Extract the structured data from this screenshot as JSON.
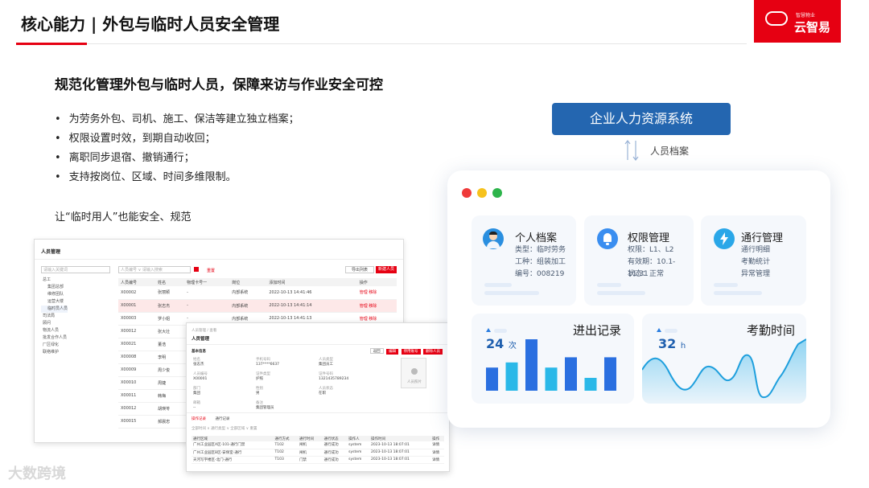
{
  "header": {
    "title": "核心能力 | 外包与临时人员安全管理",
    "logo_small": "智慧物业",
    "logo_brand": "云智易"
  },
  "colors": {
    "brand_red": "#e60012",
    "primary_blue": "#2466b0"
  },
  "subtitle": "规范化管理外包与临时人员，保障来访与作业安全可控",
  "bullets": [
    "为劳务外包、司机、施工、保洁等建立独立档案；",
    "权限设置时效，到期自动收回；",
    "离职同步退宿、撤销通行；",
    "支持按岗位、区域、时间多维限制。"
  ],
  "note": "让“临时用人”也能安全、规范",
  "system": {
    "label": "企业人力资源系统",
    "arrow_label": "人员档案"
  },
  "cards": {
    "profile": {
      "title": "个人档案",
      "lines": [
        "类型：临时劳务",
        "工种：组装加工",
        "编号：008219"
      ]
    },
    "permission": {
      "title": "权限管理",
      "lines": [
        "权限：L1、L2",
        "有效期：10.1-11.31",
        "状态：正常"
      ]
    },
    "access": {
      "title": "通行管理",
      "lines": [
        "通行明细",
        "考勤统计",
        "异常管理"
      ]
    },
    "records": {
      "title": "进出记录",
      "value": "24",
      "unit": "次",
      "bars": [
        0.45,
        0.55,
        1.0,
        0.45,
        0.65,
        0.25,
        0.65
      ]
    },
    "attendance": {
      "title": "考勤时间",
      "value": "32",
      "unit": "h"
    }
  },
  "screenshot1": {
    "title": "人员管理",
    "search_placeholder": "请输入关键词",
    "tree": [
      "总工",
      "集团总部",
      "维修团队",
      "运营大楼",
      "临时员人员",
      "司法局",
      "顾问",
      "物流人员",
      "批发合作人员",
      "厂区绿化",
      "联络维护"
    ],
    "filter": "人员编号 ∨  请输入搜索",
    "reset": "重置",
    "export": "导出列表",
    "add": "新建人员",
    "columns": [
      "人员编号",
      "姓名",
      "物理卡号一",
      "岗位",
      "添加时间",
      "操作"
    ],
    "rows": [
      [
        "X00002",
        "张丽颖",
        "-",
        "内部系统",
        "2022-10-13 14:41:46",
        "管理  移除"
      ],
      [
        "X00001",
        "张志杰",
        "-",
        "内部系统",
        "2022-10-13 14:41:14",
        "管理  移除"
      ],
      [
        "X00003",
        "罗小姐",
        "-",
        "内部系统",
        "2022-10-13 14:41:13",
        "管理  移除"
      ],
      [
        "X00012",
        "张大壮",
        "",
        "",
        "",
        "管理  移除"
      ],
      [
        "X00021",
        "董浩",
        "",
        "",
        "",
        "管理  移除"
      ],
      [
        "X00008",
        "李明",
        "",
        "",
        "",
        "管理  移除"
      ],
      [
        "X00009",
        "周少俊",
        "",
        "",
        "",
        "管理  移除"
      ],
      [
        "X00010",
        "周婕",
        "",
        "",
        "",
        "管理  移除"
      ],
      [
        "X00011",
        "韩梅",
        "",
        "",
        "",
        "管理  移除"
      ],
      [
        "X00012",
        "胡瑛苓",
        "",
        "",
        "",
        "管理  移除"
      ],
      [
        "X00015",
        "郝晨忠",
        "",
        "",
        "",
        "管理  移除"
      ]
    ]
  },
  "screenshot2": {
    "crumb": "人员管理 / 查看",
    "title": "人员管理",
    "section": "基本信息",
    "buttons": [
      "返回",
      "编辑",
      "停用账号",
      "删除人员"
    ],
    "fields": [
      {
        "k": "姓名",
        "v": "张志杰"
      },
      {
        "k": "手机号码",
        "v": "137****6637"
      },
      {
        "k": "人员类型",
        "v": "集团员工"
      },
      {
        "k": "人员编号",
        "v": "X00001"
      },
      {
        "k": "证件类型",
        "v": "护照"
      },
      {
        "k": "证件号码",
        "v": "1321435789234"
      },
      {
        "k": "部门",
        "v": "集团"
      },
      {
        "k": "性别",
        "v": "男"
      },
      {
        "k": "人员状态",
        "v": "在职"
      },
      {
        "k": "邮箱",
        "v": "--"
      },
      {
        "k": "备注",
        "v": "集团管理员"
      }
    ],
    "photo_label": "人员照片",
    "tabs": [
      "操作记录",
      "通行记录"
    ],
    "filters": "全部时间 ∨    通行类型 ∨    全部区域 ∨      重置",
    "columns": [
      "通行区域",
      "通行方式",
      "通行时间",
      "通行状态",
      "操作人",
      "操作时间",
      "操作"
    ],
    "rows": [
      [
        "广州工业园区A区-101-通行门禁",
        "T102",
        "闸机",
        "通行成功",
        "system",
        "2023-10-13 18:07:01",
        "详情"
      ],
      [
        "广州工业园区B区-安保室-通行",
        "T102",
        "闸机",
        "通行成功",
        "system",
        "2023-10-13 18:07:01",
        "详情"
      ],
      [
        "天河写字楼区-北门-通行",
        "T103",
        "门禁",
        "通行成功",
        "system",
        "2023-10-13 18:07:01",
        "详情"
      ]
    ]
  },
  "watermark": "大数跨境"
}
